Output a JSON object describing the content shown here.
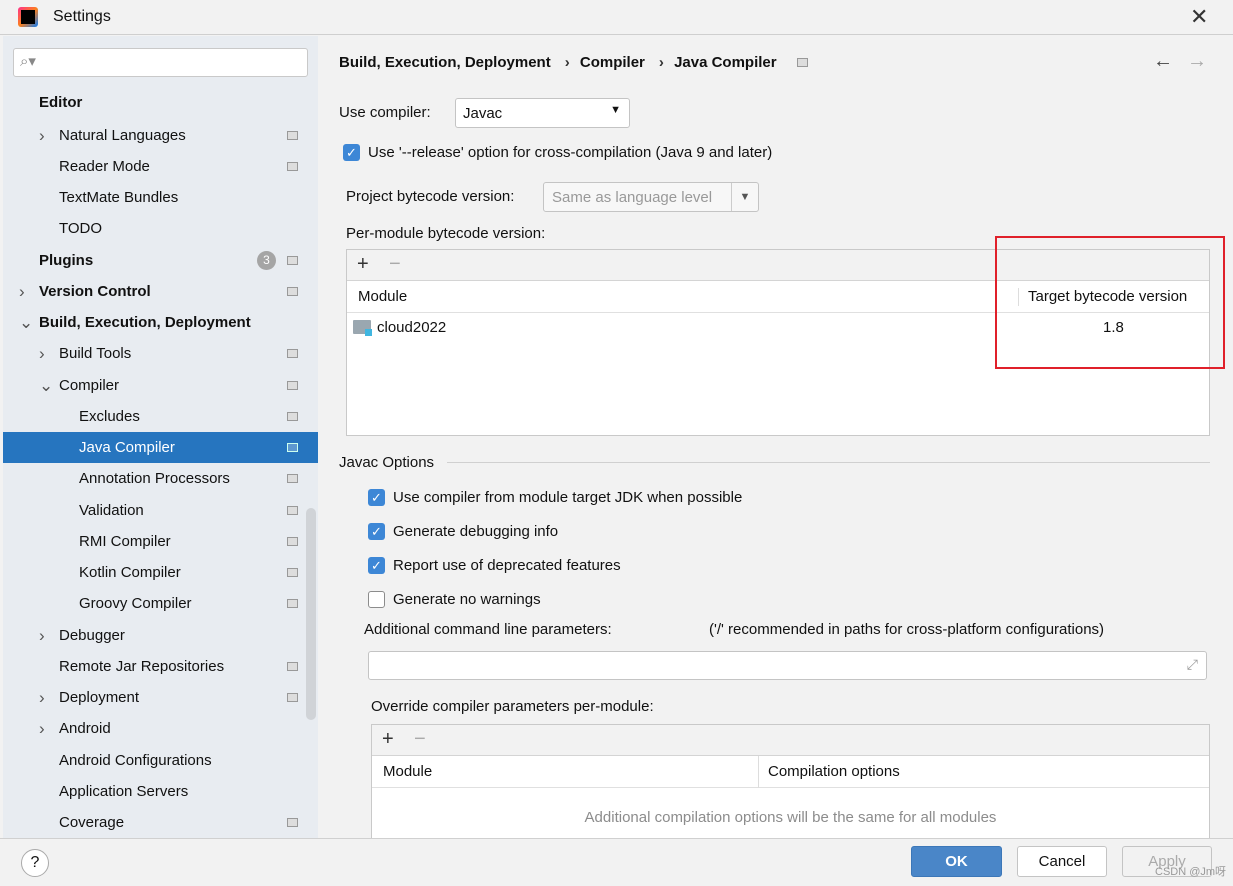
{
  "window": {
    "title": "Settings",
    "close": "✕"
  },
  "sidebar": {
    "search_placeholder": "",
    "items": [
      {
        "label": "Editor"
      },
      {
        "label": "Natural Languages"
      },
      {
        "label": "Reader Mode"
      },
      {
        "label": "TextMate Bundles"
      },
      {
        "label": "TODO"
      },
      {
        "label": "Plugins",
        "badge": "3"
      },
      {
        "label": "Version Control"
      },
      {
        "label": "Build, Execution, Deployment"
      },
      {
        "label": "Build Tools"
      },
      {
        "label": "Compiler"
      },
      {
        "label": "Excludes"
      },
      {
        "label": "Java Compiler"
      },
      {
        "label": "Annotation Processors"
      },
      {
        "label": "Validation"
      },
      {
        "label": "RMI Compiler"
      },
      {
        "label": "Kotlin Compiler"
      },
      {
        "label": "Groovy Compiler"
      },
      {
        "label": "Debugger"
      },
      {
        "label": "Remote Jar Repositories"
      },
      {
        "label": "Deployment"
      },
      {
        "label": "Android"
      },
      {
        "label": "Android Configurations"
      },
      {
        "label": "Application Servers"
      },
      {
        "label": "Coverage"
      }
    ]
  },
  "breadcrumb": [
    "Build, Execution, Deployment",
    "Compiler",
    "Java Compiler"
  ],
  "breadcrumb_sep": "›",
  "main": {
    "use_compiler_label": "Use compiler:",
    "use_compiler_value": "Javac",
    "release_option": "Use '--release' option for cross-compilation (Java 9 and later)",
    "project_bytecode_label": "Project bytecode version:",
    "project_bytecode_value": "Same as language level",
    "per_module_label": "Per-module bytecode version:",
    "per_module_table": {
      "add": "+",
      "remove": "−",
      "col_module": "Module",
      "col_target": "Target bytecode version",
      "rows": [
        {
          "module": "cloud2022",
          "target": "1.8"
        }
      ]
    },
    "javac_options_title": "Javac Options",
    "options": [
      {
        "label": "Use compiler from module target JDK when possible",
        "checked": true
      },
      {
        "label": "Generate debugging info",
        "checked": true
      },
      {
        "label": "Report use of deprecated features",
        "checked": true
      },
      {
        "label": "Generate no warnings",
        "checked": false
      }
    ],
    "additional_params_label": "Additional command line parameters:",
    "additional_params_hint": "('/' recommended in paths for cross-platform configurations)",
    "additional_params_value": "",
    "override_label": "Override compiler parameters per-module:",
    "override_table": {
      "add": "+",
      "remove": "−",
      "col_module": "Module",
      "col_options": "Compilation options",
      "empty_text": "Additional compilation options will be the same for all modules"
    }
  },
  "footer": {
    "help": "?",
    "ok": "OK",
    "cancel": "Cancel",
    "apply": "Apply",
    "watermark": "CSDN @Jm呀"
  },
  "colors": {
    "accent": "#2675bf",
    "highlight_box": "#e0202a"
  }
}
